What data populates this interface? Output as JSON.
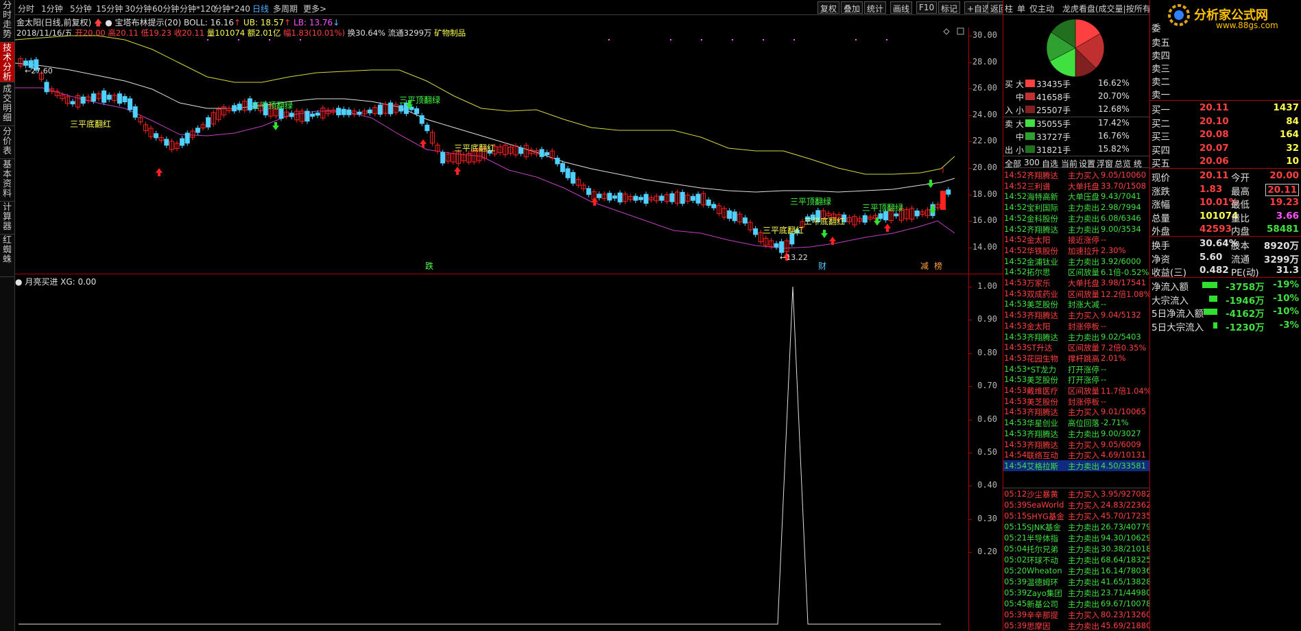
{
  "vtabs": [
    {
      "label": "分时走势"
    },
    {
      "label": "技术分析"
    },
    {
      "label": "成交明细"
    },
    {
      "label": "分价表"
    },
    {
      "label": "基本资料"
    },
    {
      "label": "计算器"
    },
    {
      "label": "红蜘蛛"
    }
  ],
  "toolbar": {
    "periods": [
      "分时",
      "1分钟",
      "5分钟",
      "15分钟",
      "30分钟",
      "60分钟",
      "分钟*120",
      "分钟*240",
      "日线",
      "多周期",
      "更多>"
    ],
    "right": [
      "复权",
      "叠加",
      "统计",
      "画线",
      "F10",
      "标记",
      "+自选",
      "返回"
    ]
  },
  "info": {
    "name": "金太阳(日线,前复权)",
    "indicator": "宝塔布林提示(20)",
    "boll": "BOLL: 16.16",
    "ub": "UB: 18.57",
    "lb": "LB: 13.76",
    "date": "2018/11/16/五",
    "open": "开20.00",
    "high": "高20.11",
    "low": "低19.23",
    "close": "收20.11",
    "vol": "量101074",
    "amount": "额2.01亿",
    "chg": "幅1.83(10.01%)",
    "turn": "换30.64%",
    "float": "流通3299万",
    "industry": "矿物制品"
  },
  "main_ticks": [
    "30.00",
    "28.00",
    "26.00",
    "24.00",
    "22.00",
    "20.00",
    "18.00",
    "16.00",
    "14.00"
  ],
  "main_signals": [
    {
      "text": "三平底翻红",
      "color": "#ffff50"
    },
    {
      "text": "三平顶翻绿",
      "color": "#40ff40"
    },
    {
      "text": "三平顶翻绿",
      "color": "#40ff40"
    },
    {
      "text": "三平底翻红",
      "color": "#ffff50"
    },
    {
      "text": "三平顶翻绿",
      "color": "#40ff40"
    },
    {
      "text": "三平底翻红",
      "color": "#ffff50"
    },
    {
      "text": "三平底翻红",
      "color": "#ffff50"
    },
    {
      "text": "三平顶翻绿",
      "color": "#40ff40"
    }
  ],
  "main_price_labels": [
    "27.60",
    "13.22"
  ],
  "main_bottom_labels": [
    "跌",
    "财",
    "减",
    "榜"
  ],
  "sub": {
    "title": "月亮买进",
    "value": "XG: 0.00",
    "ticks": [
      "1.00",
      "0.90",
      "0.80",
      "0.70",
      "0.60",
      "0.50",
      "0.40",
      "0.30",
      "0.20"
    ]
  },
  "panel": {
    "tabs": [
      "柱",
      "单",
      "仅主动",
      "龙虎看盘(成交量|按所有)"
    ],
    "buy": [
      {
        "side": "买",
        "size": "大",
        "vol": "33435手",
        "pct": "16.62%",
        "color": "#ff4040"
      },
      {
        "side": "",
        "size": "中",
        "vol": "41658手",
        "pct": "20.70%",
        "color": "#c03030"
      },
      {
        "side": "入",
        "size": "小",
        "vol": "25507手",
        "pct": "12.68%",
        "color": "#802020"
      }
    ],
    "sell": [
      {
        "side": "卖",
        "size": "大",
        "vol": "35055手",
        "pct": "17.42%",
        "color": "#40e040"
      },
      {
        "side": "",
        "size": "中",
        "vol": "33727手",
        "pct": "16.76%",
        "color": "#30a030"
      },
      {
        "side": "出",
        "size": "小",
        "vol": "31821手",
        "pct": "15.82%",
        "color": "#207020"
      }
    ],
    "listtabs": [
      "全部",
      "300",
      "自选",
      "当前",
      "设置",
      "浮窗",
      "总览",
      "统"
    ],
    "trades": [
      {
        "t": "14:52",
        "n": "齐翔腾达",
        "a": "主力买入",
        "v": "9.05/10060",
        "c": "r"
      },
      {
        "t": "14:52",
        "n": "三利谱",
        "a": "大单托盘",
        "v": "33.70/1508",
        "c": "r"
      },
      {
        "t": "14:52",
        "n": "海特高新",
        "a": "大单压盘",
        "v": "9.43/7041",
        "c": "g"
      },
      {
        "t": "14:52",
        "n": "宝利国际",
        "a": "主力卖出",
        "v": "2.98/7994",
        "c": "g"
      },
      {
        "t": "14:52",
        "n": "金科股份",
        "a": "主力卖出",
        "v": "6.08/6346",
        "c": "g"
      },
      {
        "t": "14:52",
        "n": "齐翔腾达",
        "a": "主力卖出",
        "v": "9.00/3534",
        "c": "g"
      },
      {
        "t": "14:52",
        "n": "金太阳",
        "a": "接近涨停",
        "v": "--",
        "c": "r"
      },
      {
        "t": "14:52",
        "n": "华铁股份",
        "a": "加速拉升",
        "v": "2.30%",
        "c": "r"
      },
      {
        "t": "14:52",
        "n": "金浦钛业",
        "a": "主力卖出",
        "v": "3.92/6000",
        "c": "g"
      },
      {
        "t": "14:52",
        "n": "拓尔思",
        "a": "区间放量",
        "v": "6.1倍-0.52%",
        "c": "g"
      },
      {
        "t": "14:53",
        "n": "万家乐",
        "a": "大单托盘",
        "v": "3.98/17541",
        "c": "r"
      },
      {
        "t": "14:53",
        "n": "双成药业",
        "a": "区间放量",
        "v": "12.2倍1.08%",
        "c": "r"
      },
      {
        "t": "14:53",
        "n": "美芝股份",
        "a": "封涨大减",
        "v": "--",
        "c": "g"
      },
      {
        "t": "14:53",
        "n": "齐翔腾达",
        "a": "主力买入",
        "v": "9.04/5132",
        "c": "r"
      },
      {
        "t": "14:53",
        "n": "金太阳",
        "a": "封涨停板",
        "v": "--",
        "c": "r"
      },
      {
        "t": "14:53",
        "n": "齐翔腾达",
        "a": "主力卖出",
        "v": "9.02/5403",
        "c": "g"
      },
      {
        "t": "14:53",
        "n": "ST升达",
        "a": "区间放量",
        "v": "7.2倍0.35%",
        "c": "r"
      },
      {
        "t": "14:53",
        "n": "花园生物",
        "a": "撑杆跳高",
        "v": "2.01%",
        "c": "r"
      },
      {
        "t": "14:53",
        "n": "*ST龙力",
        "a": "打开涨停",
        "v": "--",
        "c": "g"
      },
      {
        "t": "14:53",
        "n": "美芝股份",
        "a": "打开涨停",
        "v": "--",
        "c": "g"
      },
      {
        "t": "14:53",
        "n": "戴维医疗",
        "a": "区间放量",
        "v": "11.7倍1.04%",
        "c": "r"
      },
      {
        "t": "14:53",
        "n": "美芝股份",
        "a": "封涨停板",
        "v": "--",
        "c": "r"
      },
      {
        "t": "14:53",
        "n": "齐翔腾达",
        "a": "主力买入",
        "v": "9.01/10065",
        "c": "r"
      },
      {
        "t": "14:53",
        "n": "华星创业",
        "a": "高位回落",
        "v": "-2.71%",
        "c": "g"
      },
      {
        "t": "14:53",
        "n": "齐翔腾达",
        "a": "主力卖出",
        "v": "9.00/3027",
        "c": "g"
      },
      {
        "t": "14:53",
        "n": "齐翔腾达",
        "a": "主力买入",
        "v": "9.05/6009",
        "c": "r"
      },
      {
        "t": "14:54",
        "n": "联络互动",
        "a": "主力买入",
        "v": "4.69/10131",
        "c": "r"
      },
      {
        "t": "14:54",
        "n": "艾格拉斯",
        "a": "主力卖出",
        "v": "4.50/33581",
        "c": "g",
        "sel": true
      }
    ],
    "us": [
      {
        "t": "05:12",
        "n": "沙尘暴黄",
        "a": "主力买入",
        "v": "3.95/927082",
        "c": "r"
      },
      {
        "t": "05:39",
        "n": "SeaWorld",
        "a": "主力买入",
        "v": "24.83/22362",
        "c": "r"
      },
      {
        "t": "05:15",
        "n": "SHYG基金",
        "a": "主力买入",
        "v": "45.70/17235",
        "c": "r"
      },
      {
        "t": "05:15",
        "n": "SJNK基金",
        "a": "主力卖出",
        "v": "26.73/40779",
        "c": "g"
      },
      {
        "t": "05:21",
        "n": "半导体指",
        "a": "主力卖出",
        "v": "94.30/10629",
        "c": "g"
      },
      {
        "t": "05:04",
        "n": "托尔兄弟",
        "a": "主力卖出",
        "v": "30.38/21018",
        "c": "g"
      },
      {
        "t": "05:02",
        "n": "环球不动",
        "a": "主力卖出",
        "v": "68.64/18325",
        "c": "g"
      },
      {
        "t": "05:20",
        "n": "Wheaton",
        "a": "主力卖出",
        "v": "16.14/78036",
        "c": "g"
      },
      {
        "t": "05:39",
        "n": "温德姆环",
        "a": "主力卖出",
        "v": "41.65/13828",
        "c": "g"
      },
      {
        "t": "05:39",
        "n": "Zayo集团",
        "a": "主力卖出",
        "v": "23.71/44980",
        "c": "g"
      },
      {
        "t": "05:45",
        "n": "新基公司",
        "a": "主力卖出",
        "v": "69.67/10078",
        "c": "g"
      },
      {
        "t": "05:39",
        "n": "辛辛那提",
        "a": "主力买入",
        "v": "80.23/13260",
        "c": "r"
      },
      {
        "t": "05:39",
        "n": "思摩因",
        "a": "主力卖出",
        "v": "45.69/21880",
        "c": "r"
      }
    ]
  },
  "quote": {
    "logo": "分析家公式网",
    "logo_url": "www.88gs.com",
    "weibi": "委",
    "asks": [
      "卖五",
      "卖四",
      "卖三",
      "卖二",
      "卖一"
    ],
    "bids": [
      {
        "l": "买一",
        "p": "20.11",
        "v": "1437"
      },
      {
        "l": "买二",
        "p": "20.10",
        "v": "84"
      },
      {
        "l": "买三",
        "p": "20.08",
        "v": "164"
      },
      {
        "l": "买四",
        "p": "20.07",
        "v": "32"
      },
      {
        "l": "买五",
        "p": "20.06",
        "v": "10"
      }
    ],
    "stats": [
      {
        "l1": "现价",
        "v1": "20.11",
        "c1": "r",
        "l2": "今开",
        "v2": "20.00",
        "c2": "r"
      },
      {
        "l1": "涨跌",
        "v1": "1.83",
        "c1": "r",
        "l2": "最高",
        "v2": "20.11",
        "c2": "r",
        "box2": true
      },
      {
        "l1": "涨幅",
        "v1": "10.01%",
        "c1": "r",
        "l2": "最低",
        "v2": "19.23",
        "c2": "r"
      },
      {
        "l1": "总量",
        "v1": "101074",
        "c1": "y",
        "l2": "量比",
        "v2": "3.66",
        "c2": "m"
      },
      {
        "l1": "外盘",
        "v1": "42593",
        "c1": "r",
        "l2": "内盘",
        "v2": "58481",
        "c2": "g"
      }
    ],
    "stats2": [
      {
        "l1": "换手",
        "v1": "30.64%",
        "l2": "股本",
        "v2": "8920万"
      },
      {
        "l1": "净资",
        "v1": "5.60",
        "l2": "流通",
        "v2": "3299万"
      },
      {
        "l1": "收益(三)",
        "v1": "0.482",
        "l2": "PE(动)",
        "v2": "31.3"
      }
    ],
    "flows": [
      {
        "l": "净流入额",
        "v": "-3758万",
        "p": "-19%",
        "w": 22
      },
      {
        "l": "大宗流入",
        "v": "-1946万",
        "p": "-10%",
        "w": 12
      },
      {
        "l": "5日净流入额",
        "v": "-4162万",
        "p": "-10%",
        "w": 20
      },
      {
        "l": "5日大宗流入",
        "v": "-1230万",
        "p": "-3%",
        "w": 6
      }
    ]
  }
}
